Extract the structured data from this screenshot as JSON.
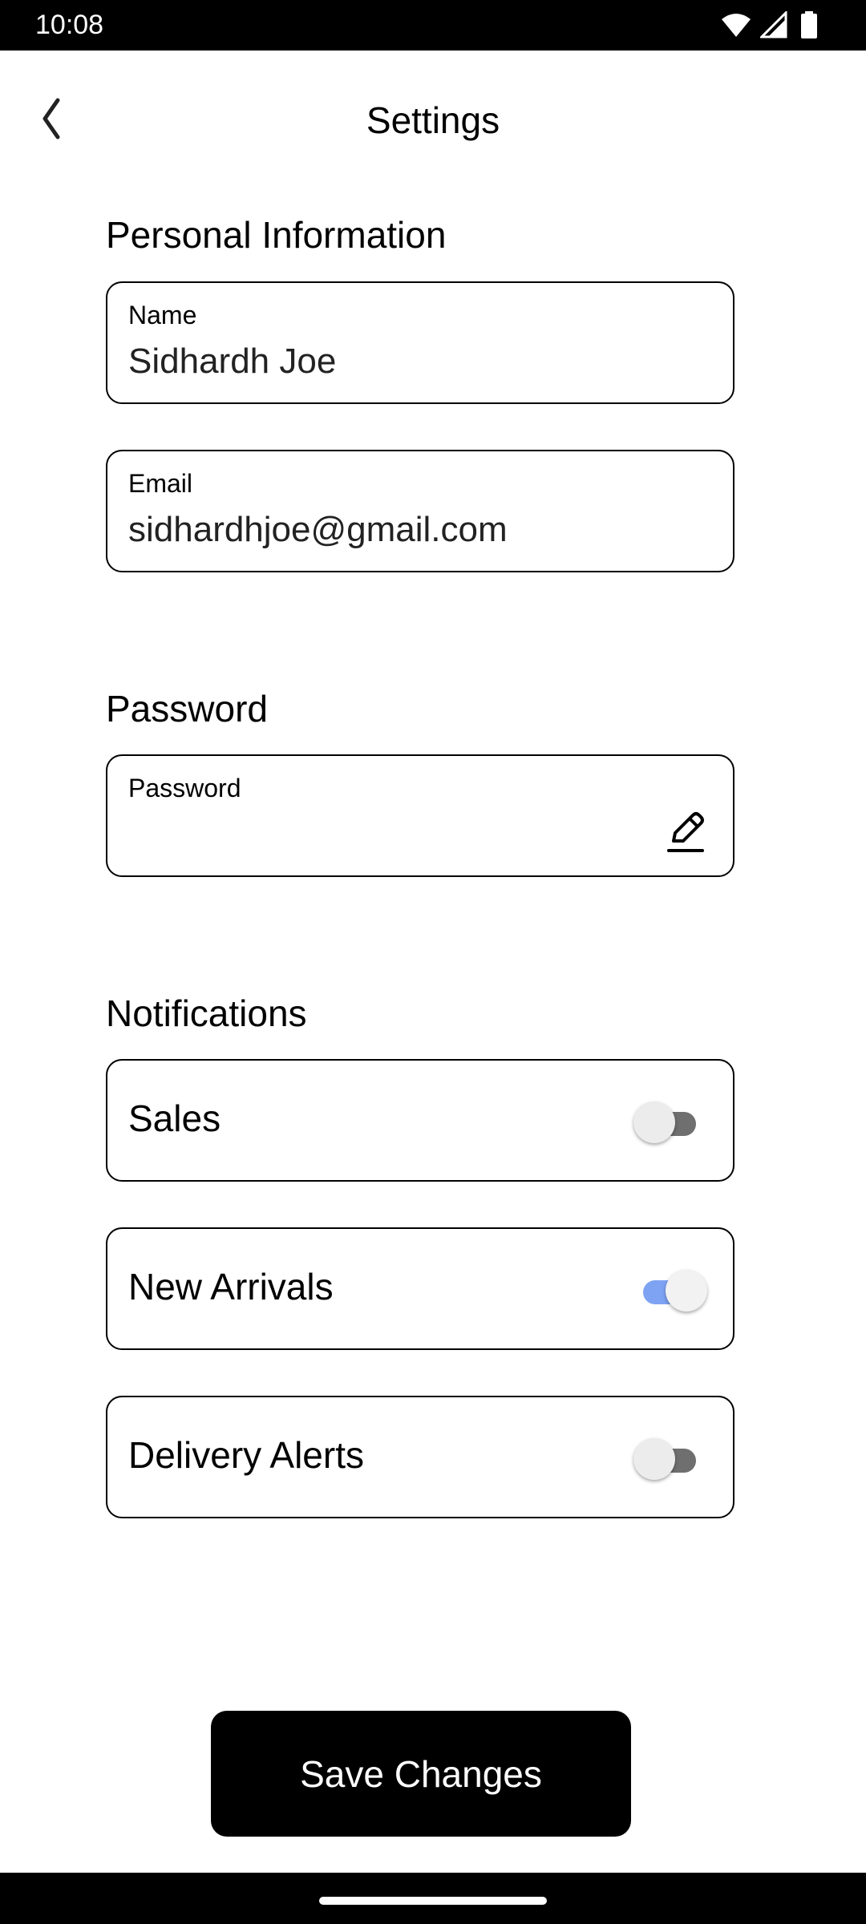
{
  "status_bar": {
    "time": "10:08",
    "icons": [
      "wifi-icon",
      "signal-icon",
      "battery-icon"
    ]
  },
  "header": {
    "title": "Settings",
    "back_icon": "chevron-left-icon"
  },
  "personal_info": {
    "title": "Personal Information",
    "name": {
      "label": "Name",
      "value": "Sidhardh Joe"
    },
    "email": {
      "label": "Email",
      "value": "sidhardhjoe@gmail.com"
    }
  },
  "password_section": {
    "title": "Password",
    "field": {
      "label": "Password",
      "value": "",
      "edit_icon": "pencil-icon"
    }
  },
  "notifications": {
    "title": "Notifications",
    "items": [
      {
        "label": "Sales",
        "enabled": false
      },
      {
        "label": "New Arrivals",
        "enabled": true
      },
      {
        "label": "Delivery Alerts",
        "enabled": false
      }
    ]
  },
  "actions": {
    "save_label": "Save Changes"
  },
  "colors": {
    "primary": "#000000",
    "toggle_on_track": "#7ea3f3",
    "toggle_off_track": "#6f6f6f"
  }
}
